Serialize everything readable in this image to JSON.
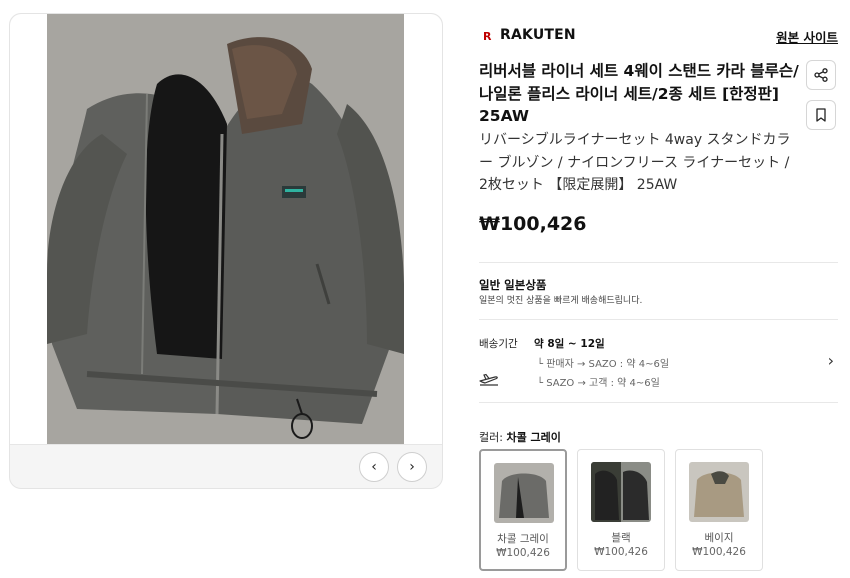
{
  "gallery": {
    "prev_symbol": "‹",
    "next_symbol": "›",
    "photo_icon": "jacket-photo"
  },
  "store": {
    "logo_text": "R",
    "name": "RAKUTEN",
    "origin_link": "원본 사이트"
  },
  "product": {
    "title_ko": "리버서블 라이너 세트 4웨이 스탠드 카라 블루슨/나일론 플리스 라이너 세트/2종 세트 [한정판] 25AW",
    "title_ja": "リバーシブルライナーセット 4way スタンドカラー ブルゾン / ナイロンフリース ライナーセット / 2枚セット 【限定展開】 25AW",
    "price": "₩100,426"
  },
  "category": {
    "title": "일반 일본상품",
    "subtitle": "일본의 멋진 상품을 빠르게 배송해드립니다."
  },
  "shipping": {
    "label": "배송기간",
    "period": "약 8일 ~ 12일",
    "step1": "└ 판매자 → SAZO : 약 4~6일",
    "step2": "└ SAZO → 고객 : 약 4~6일"
  },
  "color": {
    "label_prefix": "컬러: ",
    "selected": "차콜 그레이",
    "options": [
      {
        "name": "차콜 그레이",
        "price": "₩100,426",
        "color": "#6b6b68"
      },
      {
        "name": "블랙",
        "price": "₩100,426",
        "color": "#2b2b2b"
      },
      {
        "name": "베이지",
        "price": "₩100,426",
        "color": "#a89a82"
      }
    ]
  },
  "colors": {
    "brand_red": "#bf0000",
    "jacket_gray": "#5e5f5c"
  }
}
